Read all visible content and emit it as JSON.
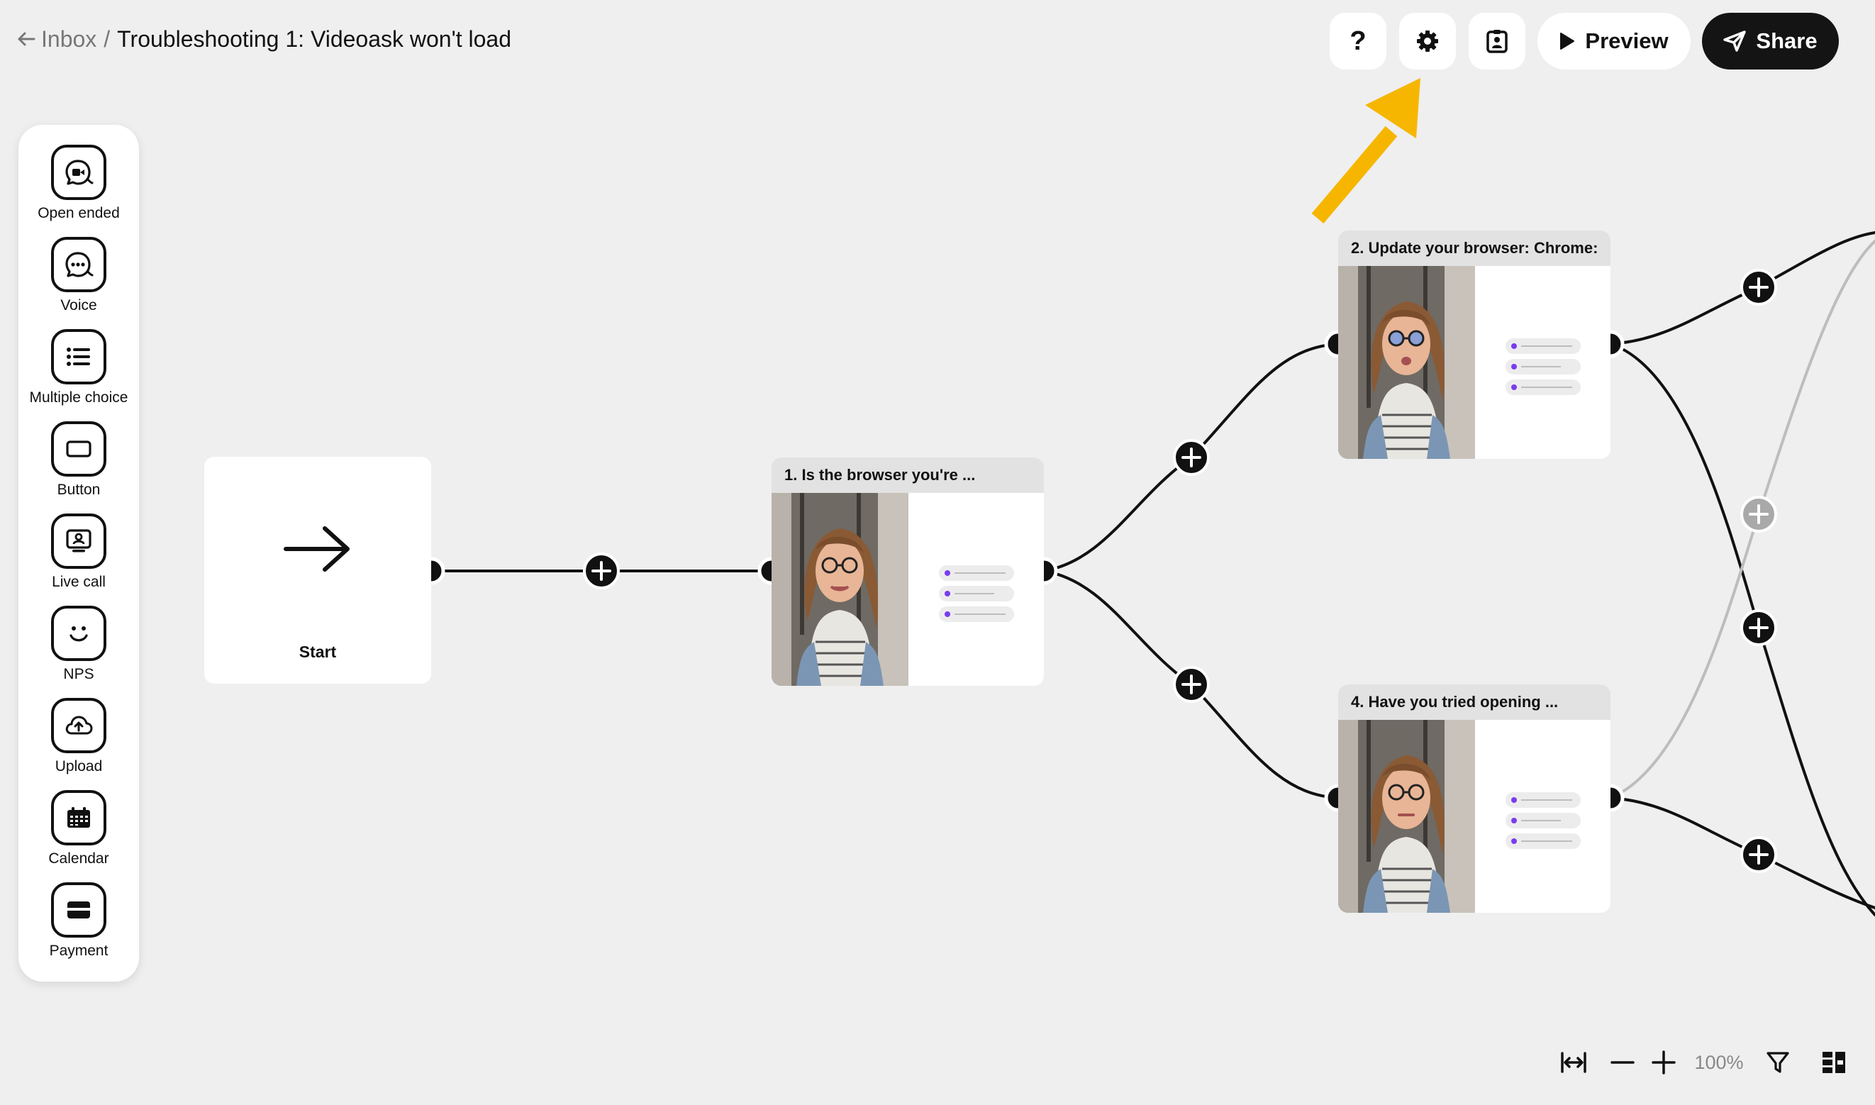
{
  "header": {
    "back_label": "Inbox",
    "separator": "/",
    "title": "Troubleshooting 1: Videoask won't load"
  },
  "toolbar": {
    "help_label": "?",
    "preview_label": "Preview",
    "share_label": "Share",
    "accent_color": "#f6b600",
    "share_bg": "#141414"
  },
  "palette": {
    "items": [
      {
        "label": "Open ended",
        "icon": "video-chat-icon"
      },
      {
        "label": "Voice",
        "icon": "voice-chat-icon"
      },
      {
        "label": "Multiple choice",
        "icon": "list-icon"
      },
      {
        "label": "Button",
        "icon": "button-icon"
      },
      {
        "label": "Live call",
        "icon": "live-call-icon"
      },
      {
        "label": "NPS",
        "icon": "smiley-icon"
      },
      {
        "label": "Upload",
        "icon": "cloud-upload-icon"
      },
      {
        "label": "Calendar",
        "icon": "calendar-icon"
      },
      {
        "label": "Payment",
        "icon": "payment-icon"
      }
    ]
  },
  "canvas": {
    "start_label": "Start",
    "nodes": [
      {
        "title": "1. Is the browser you're ..."
      },
      {
        "title": "2. Update your browser: Chrome:"
      },
      {
        "title": "4. Have you tried opening ..."
      }
    ]
  },
  "bottom_toolbar": {
    "zoom_level": "100%"
  }
}
